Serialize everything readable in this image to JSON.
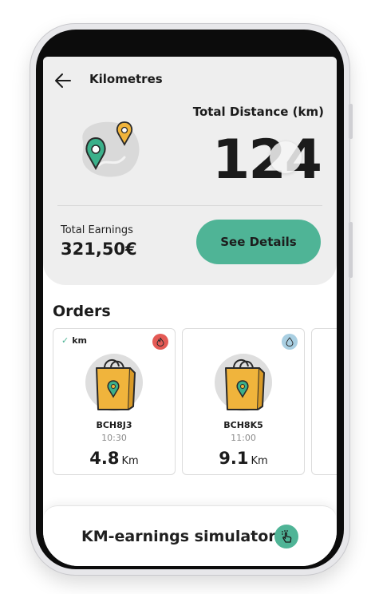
{
  "header": {
    "title": "Kilometres",
    "distance_label": "Total Distance (km)",
    "distance_value": "124",
    "earnings_label": "Total Earnings",
    "earnings_value": "321,50€",
    "details_button": "See Details"
  },
  "orders": {
    "title": "Orders",
    "items": [
      {
        "badge": "km",
        "type_icon": "fire-icon",
        "code": "BCH8J3",
        "time": "10:30",
        "distance": "4.8",
        "unit": "Km"
      },
      {
        "badge": "",
        "type_icon": "water-drop-icon",
        "code": "BCH8K5",
        "time": "11:00",
        "distance": "9.1",
        "unit": "Km"
      }
    ]
  },
  "simulator": {
    "label": "KM-earnings simulator",
    "icon": "tap-icon"
  },
  "colors": {
    "accent": "#4fb496",
    "fire": "#e45a55",
    "drop": "#a9cfe2",
    "bag": "#f0b43c"
  }
}
